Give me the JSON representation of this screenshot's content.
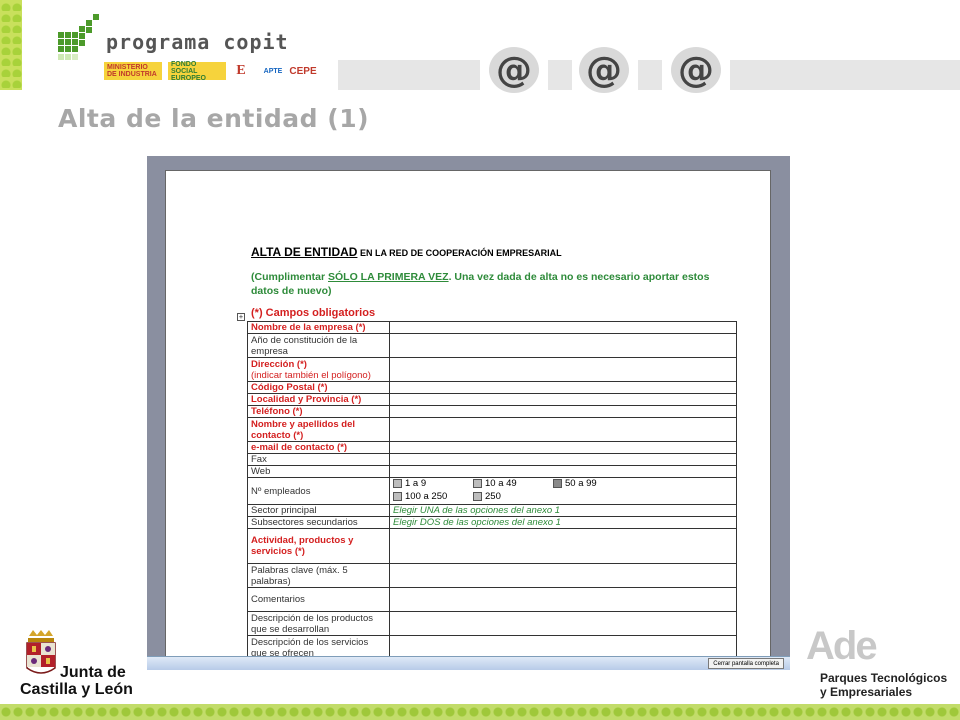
{
  "header": {
    "brand": "programa copit",
    "sponsors": [
      "MINISTERIO DE INDUSTRIA",
      "FONDO SOCIAL EUROPEO",
      "E",
      "APTE",
      "CEPE"
    ],
    "page_title": "Alta de la entidad (1)"
  },
  "document": {
    "heading_main": "ALTA DE ENTIDAD",
    "heading_rest": " EN LA RED DE COOPERACIÓN EMPRESARIAL",
    "note_pre": "(Cumplimentar ",
    "note_underlined": "SÓLO LA PRIMERA VEZ",
    "note_post": ". Una vez dada de alta no es necesario aportar estos datos de nuevo)",
    "required_label": "(*) Campos obligatorios",
    "rows": [
      {
        "label": "Nombre de la empresa (*)",
        "required": true,
        "value": ""
      },
      {
        "label": "Año de constitución de la empresa",
        "required": false,
        "value": ""
      },
      {
        "label": "Dirección (*)",
        "sub": "(indicar también el polígono)",
        "required": true,
        "value": ""
      },
      {
        "label": "Código Postal (*)",
        "required": true,
        "value": ""
      },
      {
        "label": "Localidad y Provincia (*)",
        "required": true,
        "value": ""
      },
      {
        "label": "Teléfono (*)",
        "required": true,
        "value": ""
      },
      {
        "label": "Nombre y apellidos del contacto (*)",
        "required": true,
        "value": ""
      },
      {
        "label": "e-mail de contacto (*)",
        "required": true,
        "value": ""
      },
      {
        "label": "Fax",
        "required": false,
        "value": ""
      },
      {
        "label": "Web",
        "required": false,
        "value": ""
      },
      {
        "label": "Nº empleados",
        "required": false,
        "options": [
          "1 a 9",
          "10 a 49",
          "50 a 99",
          "100 a 250",
          "250"
        ]
      },
      {
        "label": "Sector principal",
        "required": false,
        "hint": "Elegir UNA de las opciones del anexo 1"
      },
      {
        "label": "Subsectores secundarios",
        "required": false,
        "hint": "Elegir DOS de las opciones del anexo 1"
      },
      {
        "label": "Actividad, productos y servicios (*)",
        "required": true,
        "value": ""
      },
      {
        "label": "Palabras clave (máx. 5 palabras)",
        "required": false,
        "value": ""
      },
      {
        "label": "Comentarios",
        "required": false,
        "value": ""
      },
      {
        "label": "Descripción de los productos que se desarrollan",
        "required": false,
        "value": ""
      },
      {
        "label": "Descripción de los servicios que se ofrecen",
        "required": false,
        "value": ""
      }
    ]
  },
  "viewer": {
    "close_fullscreen_label": "Cerrar pantalla completa"
  },
  "footer": {
    "left_logo_line1": "Junta de",
    "left_logo_line2": "Castilla y León",
    "right_logo": "Ade",
    "right_tag_line1": "Parques Tecnológicos",
    "right_tag_line2": "y Empresariales"
  },
  "colors": {
    "title_grey": "#a7a7a7",
    "required_red": "#d42020",
    "note_green": "#2e8b3a",
    "viewer_bg": "#8a8fa0"
  }
}
